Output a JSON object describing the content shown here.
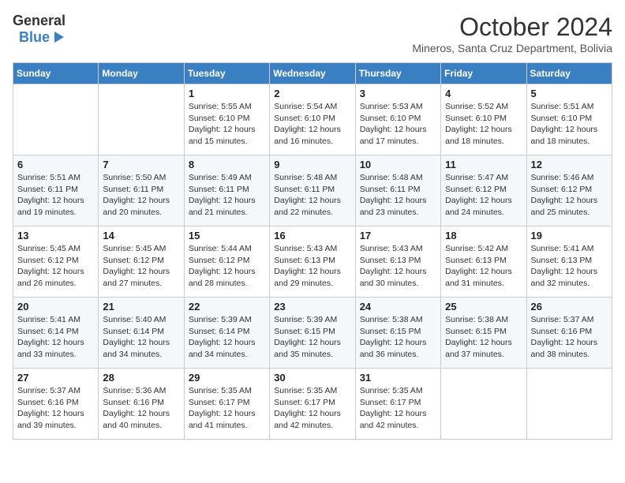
{
  "logo": {
    "general": "General",
    "blue": "Blue"
  },
  "title": "October 2024",
  "location": "Mineros, Santa Cruz Department, Bolivia",
  "days_of_week": [
    "Sunday",
    "Monday",
    "Tuesday",
    "Wednesday",
    "Thursday",
    "Friday",
    "Saturday"
  ],
  "weeks": [
    [
      {
        "day": "",
        "info": ""
      },
      {
        "day": "",
        "info": ""
      },
      {
        "day": "1",
        "info": "Sunrise: 5:55 AM\nSunset: 6:10 PM\nDaylight: 12 hours and 15 minutes."
      },
      {
        "day": "2",
        "info": "Sunrise: 5:54 AM\nSunset: 6:10 PM\nDaylight: 12 hours and 16 minutes."
      },
      {
        "day": "3",
        "info": "Sunrise: 5:53 AM\nSunset: 6:10 PM\nDaylight: 12 hours and 17 minutes."
      },
      {
        "day": "4",
        "info": "Sunrise: 5:52 AM\nSunset: 6:10 PM\nDaylight: 12 hours and 18 minutes."
      },
      {
        "day": "5",
        "info": "Sunrise: 5:51 AM\nSunset: 6:10 PM\nDaylight: 12 hours and 18 minutes."
      }
    ],
    [
      {
        "day": "6",
        "info": "Sunrise: 5:51 AM\nSunset: 6:11 PM\nDaylight: 12 hours and 19 minutes."
      },
      {
        "day": "7",
        "info": "Sunrise: 5:50 AM\nSunset: 6:11 PM\nDaylight: 12 hours and 20 minutes."
      },
      {
        "day": "8",
        "info": "Sunrise: 5:49 AM\nSunset: 6:11 PM\nDaylight: 12 hours and 21 minutes."
      },
      {
        "day": "9",
        "info": "Sunrise: 5:48 AM\nSunset: 6:11 PM\nDaylight: 12 hours and 22 minutes."
      },
      {
        "day": "10",
        "info": "Sunrise: 5:48 AM\nSunset: 6:11 PM\nDaylight: 12 hours and 23 minutes."
      },
      {
        "day": "11",
        "info": "Sunrise: 5:47 AM\nSunset: 6:12 PM\nDaylight: 12 hours and 24 minutes."
      },
      {
        "day": "12",
        "info": "Sunrise: 5:46 AM\nSunset: 6:12 PM\nDaylight: 12 hours and 25 minutes."
      }
    ],
    [
      {
        "day": "13",
        "info": "Sunrise: 5:45 AM\nSunset: 6:12 PM\nDaylight: 12 hours and 26 minutes."
      },
      {
        "day": "14",
        "info": "Sunrise: 5:45 AM\nSunset: 6:12 PM\nDaylight: 12 hours and 27 minutes."
      },
      {
        "day": "15",
        "info": "Sunrise: 5:44 AM\nSunset: 6:12 PM\nDaylight: 12 hours and 28 minutes."
      },
      {
        "day": "16",
        "info": "Sunrise: 5:43 AM\nSunset: 6:13 PM\nDaylight: 12 hours and 29 minutes."
      },
      {
        "day": "17",
        "info": "Sunrise: 5:43 AM\nSunset: 6:13 PM\nDaylight: 12 hours and 30 minutes."
      },
      {
        "day": "18",
        "info": "Sunrise: 5:42 AM\nSunset: 6:13 PM\nDaylight: 12 hours and 31 minutes."
      },
      {
        "day": "19",
        "info": "Sunrise: 5:41 AM\nSunset: 6:13 PM\nDaylight: 12 hours and 32 minutes."
      }
    ],
    [
      {
        "day": "20",
        "info": "Sunrise: 5:41 AM\nSunset: 6:14 PM\nDaylight: 12 hours and 33 minutes."
      },
      {
        "day": "21",
        "info": "Sunrise: 5:40 AM\nSunset: 6:14 PM\nDaylight: 12 hours and 34 minutes."
      },
      {
        "day": "22",
        "info": "Sunrise: 5:39 AM\nSunset: 6:14 PM\nDaylight: 12 hours and 34 minutes."
      },
      {
        "day": "23",
        "info": "Sunrise: 5:39 AM\nSunset: 6:15 PM\nDaylight: 12 hours and 35 minutes."
      },
      {
        "day": "24",
        "info": "Sunrise: 5:38 AM\nSunset: 6:15 PM\nDaylight: 12 hours and 36 minutes."
      },
      {
        "day": "25",
        "info": "Sunrise: 5:38 AM\nSunset: 6:15 PM\nDaylight: 12 hours and 37 minutes."
      },
      {
        "day": "26",
        "info": "Sunrise: 5:37 AM\nSunset: 6:16 PM\nDaylight: 12 hours and 38 minutes."
      }
    ],
    [
      {
        "day": "27",
        "info": "Sunrise: 5:37 AM\nSunset: 6:16 PM\nDaylight: 12 hours and 39 minutes."
      },
      {
        "day": "28",
        "info": "Sunrise: 5:36 AM\nSunset: 6:16 PM\nDaylight: 12 hours and 40 minutes."
      },
      {
        "day": "29",
        "info": "Sunrise: 5:35 AM\nSunset: 6:17 PM\nDaylight: 12 hours and 41 minutes."
      },
      {
        "day": "30",
        "info": "Sunrise: 5:35 AM\nSunset: 6:17 PM\nDaylight: 12 hours and 42 minutes."
      },
      {
        "day": "31",
        "info": "Sunrise: 5:35 AM\nSunset: 6:17 PM\nDaylight: 12 hours and 42 minutes."
      },
      {
        "day": "",
        "info": ""
      },
      {
        "day": "",
        "info": ""
      }
    ]
  ]
}
